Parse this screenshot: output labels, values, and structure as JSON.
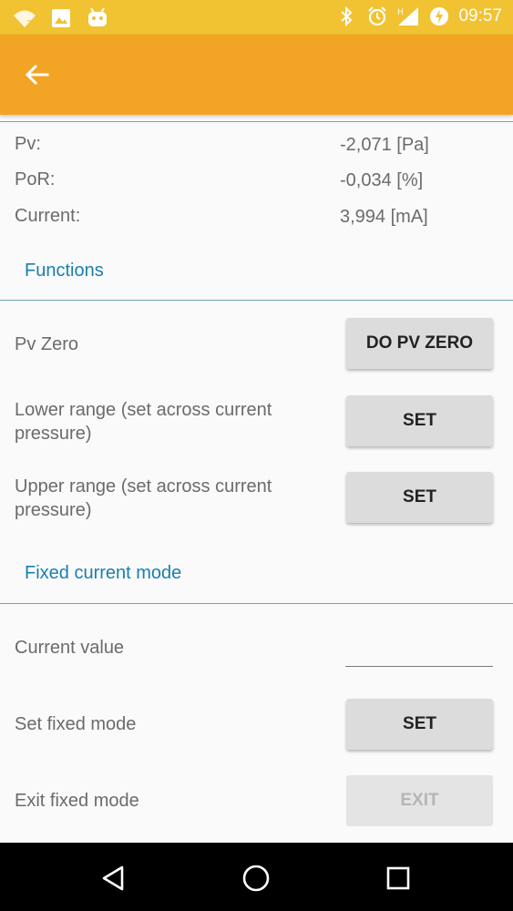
{
  "status_bar": {
    "time": "09:57",
    "icons_left": [
      "wifi-question-icon",
      "image-icon",
      "android-icon"
    ],
    "icons_right": [
      "bluetooth-icon",
      "alarm-icon",
      "signal-icon",
      "data-saver-icon"
    ]
  },
  "colors": {
    "status_bar": "#f1c232",
    "app_bar": "#f2a424",
    "section_header": "#1b7eb0",
    "divider": "#6ea6b8"
  },
  "readings": [
    {
      "label": "Pv:",
      "value": "-2,071 [Pa]"
    },
    {
      "label": "PoR:",
      "value": "-0,034 [%]"
    },
    {
      "label": "Current:",
      "value": "3,994 [mA]"
    }
  ],
  "functions": {
    "header": "Functions",
    "pv_zero_label": "Pv Zero",
    "pv_zero_button": "DO PV ZERO",
    "lower_range_label": "Lower range (set across current pressure)",
    "lower_range_button": "SET",
    "upper_range_label": "Upper range (set across current pressure)",
    "upper_range_button": "SET"
  },
  "fixed_current": {
    "header": "Fixed current mode",
    "current_value_label": "Current value",
    "current_value_input": "",
    "set_fixed_label": "Set fixed mode",
    "set_fixed_button": "SET",
    "exit_fixed_label": "Exit fixed mode",
    "exit_fixed_button": "EXIT"
  }
}
